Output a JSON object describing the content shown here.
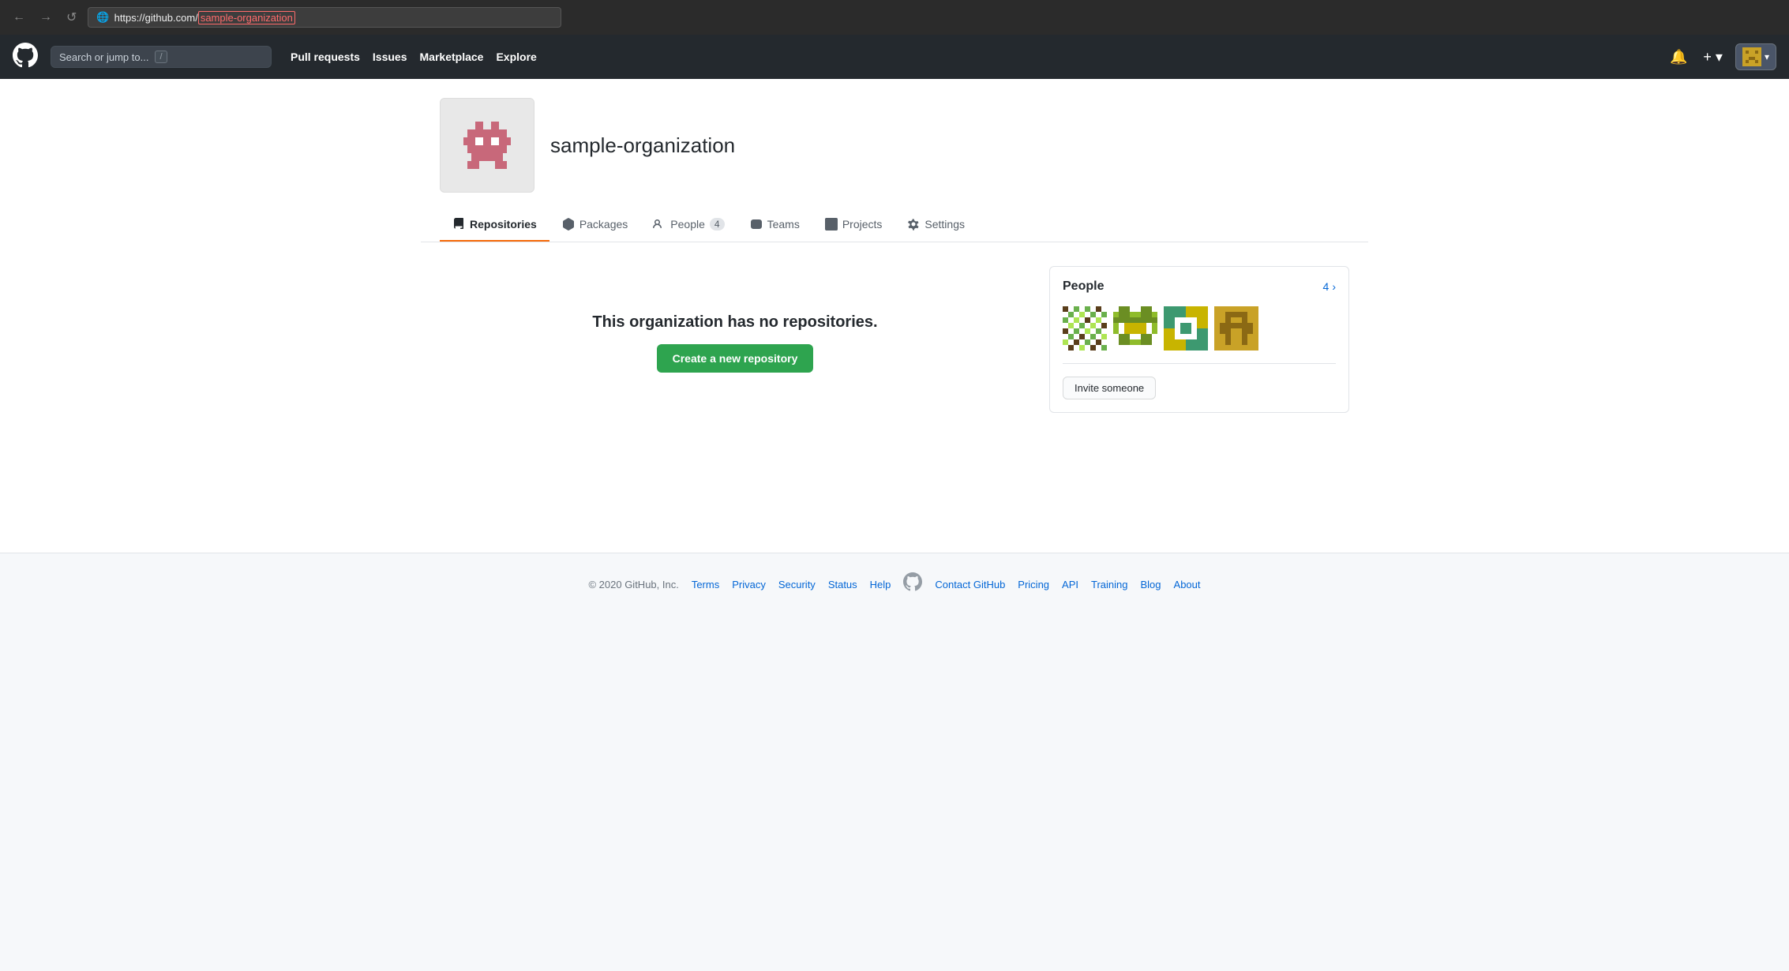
{
  "browser": {
    "back_btn": "←",
    "forward_btn": "→",
    "refresh_btn": "↺",
    "url_prefix": "https://github.com/",
    "url_org": "sample-organization"
  },
  "navbar": {
    "logo": "⬤",
    "search_placeholder": "Search or jump to...",
    "search_shortcut": "/",
    "links": [
      {
        "label": "Pull requests",
        "key": "pull-requests"
      },
      {
        "label": "Issues",
        "key": "issues"
      },
      {
        "label": "Marketplace",
        "key": "marketplace"
      },
      {
        "label": "Explore",
        "key": "explore"
      }
    ],
    "bell_icon": "🔔",
    "plus_icon": "+",
    "chevron": "▾"
  },
  "org": {
    "name": "sample-organization"
  },
  "tabs": [
    {
      "label": "Repositories",
      "icon": "repo",
      "active": true,
      "count": null
    },
    {
      "label": "Packages",
      "icon": "package",
      "active": false,
      "count": null
    },
    {
      "label": "People",
      "icon": "person",
      "active": false,
      "count": "4"
    },
    {
      "label": "Teams",
      "icon": "team",
      "active": false,
      "count": null
    },
    {
      "label": "Projects",
      "icon": "project",
      "active": false,
      "count": null
    },
    {
      "label": "Settings",
      "icon": "gear",
      "active": false,
      "count": null
    }
  ],
  "main": {
    "empty_state_text": "This organization has no repositories.",
    "create_repo_btn": "Create a new repository"
  },
  "sidebar": {
    "people_title": "People",
    "people_count": "4",
    "chevron": "›",
    "invite_btn": "Invite someone"
  },
  "footer": {
    "copyright": "© 2020 GitHub, Inc.",
    "links_left": [
      "Terms",
      "Privacy",
      "Security",
      "Status",
      "Help"
    ],
    "links_right": [
      "Contact GitHub",
      "Pricing",
      "API",
      "Training",
      "Blog",
      "About"
    ]
  }
}
